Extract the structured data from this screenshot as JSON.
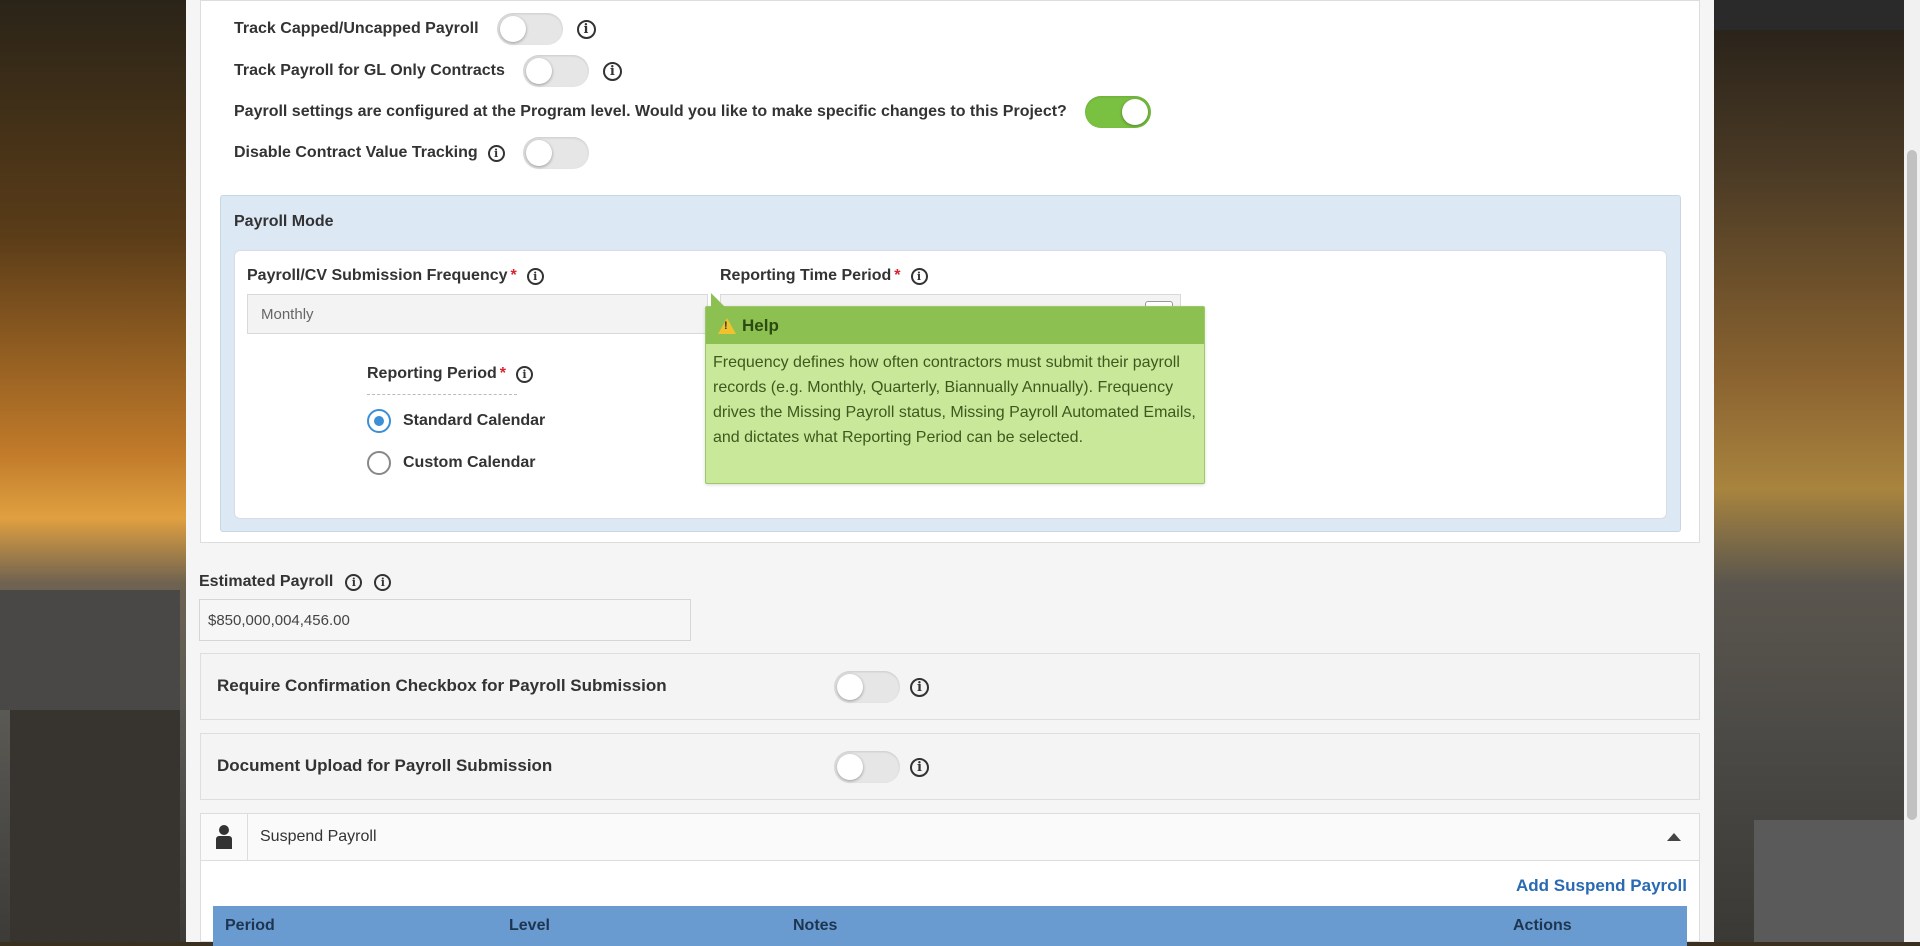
{
  "settings": {
    "track_capped": {
      "label": "Track Capped/Uncapped Payroll",
      "on": false
    },
    "track_gl_only": {
      "label": "Track Payroll for GL Only Contracts",
      "on": false
    },
    "program_level": {
      "label": "Payroll settings are configured at the Program level. Would you like to make specific changes to this Project?",
      "on": true
    },
    "disable_cv": {
      "label": "Disable Contract Value Tracking",
      "on": false
    }
  },
  "payroll_mode": {
    "title": "Payroll Mode",
    "frequency": {
      "label": "Payroll/CV Submission Frequency",
      "value": "Monthly"
    },
    "time_period": {
      "label": "Reporting Time Period",
      "value": ""
    },
    "reporting_period": {
      "label": "Reporting Period",
      "options": [
        "Standard Calendar",
        "Custom Calendar"
      ],
      "selected": "Standard Calendar"
    }
  },
  "tooltip": {
    "title": "Help",
    "body": "Frequency defines how often contractors must submit their payroll records (e.g. Monthly, Quarterly, Biannually Annually). Frequency drives the Missing Payroll status, Missing Payroll Automated Emails, and dictates what Reporting Period can be selected."
  },
  "estimated_payroll": {
    "label": "Estimated Payroll",
    "value": "$850,000,004,456.00"
  },
  "require_confirmation": {
    "label": "Require Confirmation Checkbox for Payroll Submission",
    "on": false
  },
  "document_upload": {
    "label": "Document Upload for Payroll Submission",
    "on": false
  },
  "suspend_payroll": {
    "title": "Suspend Payroll",
    "add_label": "Add Suspend Payroll",
    "columns": [
      "Period",
      "Level",
      "Notes",
      "Actions"
    ]
  },
  "colors": {
    "toggle_on": "#7ac142",
    "tooltip_bg": "#c9e89a",
    "table_header": "#6a9bd0",
    "link": "#2a6ab3"
  }
}
